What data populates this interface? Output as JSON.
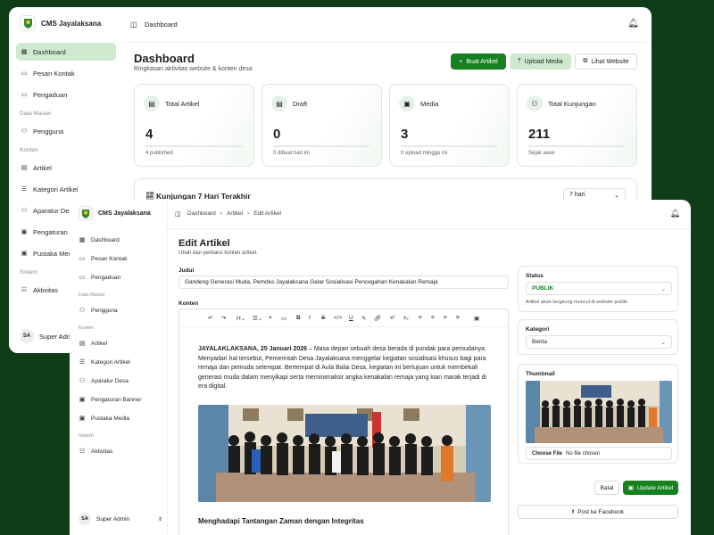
{
  "brand": {
    "name": "CMS Jayalaksana"
  },
  "dashboard": {
    "breadcrumb": "Dashboard",
    "title": "Dashboard",
    "subtitle": "Ringkasan aktivitas website & konten desa",
    "buttons": {
      "create": "Buat Artikel",
      "upload": "Upload Media",
      "view": "Lihat Website"
    },
    "stats": [
      {
        "label": "Total Artikel",
        "value": "4",
        "sub": "4 published",
        "icon": "document-icon"
      },
      {
        "label": "Draft",
        "value": "0",
        "sub": "0 dibuat hari ini",
        "icon": "draft-icon"
      },
      {
        "label": "Media",
        "value": "3",
        "sub": "0 upload minggu ini",
        "icon": "image-icon"
      },
      {
        "label": "Total Kunjungan",
        "value": "211",
        "sub": "Sejak awal",
        "icon": "users-icon"
      }
    ],
    "visits": {
      "title": "Kunjungan 7 Hari Terakhir",
      "range": "7 hari"
    }
  },
  "sidebar": {
    "items": [
      "Dashboard",
      "Pesan Kontak",
      "Pengaduan"
    ],
    "master_label": "Data Master",
    "master_items": [
      "Pengguna"
    ],
    "konten_label": "Konten",
    "konten_items_back": [
      "Artikel",
      "Kategori Artikel",
      "Aparatur Des",
      "Pengaturan B",
      "Pustaka Med"
    ],
    "konten_items": [
      "Artikel",
      "Kategori Artikel",
      "Aparatur Desa",
      "Pengaturan Banner",
      "Pustaka Media"
    ],
    "sistem_label": "Sistem",
    "sistem_items": [
      "Aktivitas"
    ],
    "user_back": "Super Admi",
    "user": "Super Admin",
    "avatar": "SA"
  },
  "editor": {
    "breadcrumb": [
      "Dashboard",
      "Artikel",
      "Edit Artikel"
    ],
    "title": "Edit Artikel",
    "subtitle": "Ubah dan perbarui konten artikel.",
    "judul_label": "Judul",
    "judul_value": "Gandeng Generasi Muda, Pemdes Jayalaksana Gelar Sosialisasi Pencegahan Kenakalan Remaja",
    "konten_label": "Konten",
    "body_lead": "JAYALAKLAKSANA, 25 Januari 2026",
    "body_text": " – Masa depan sebuah desa berada di pundak para pemudanya. Menyadari hal tersebut, Pemerintah Desa Jayalaksana menggelar kegiatan sosialisasi khusus bagi para remaja dan pemuda setempat. Bertempat di Aula Balai Desa, kegiatan ini bertujuan untuk membekali generasi muda dalam menyikapi serta meminimalisir angka kenakalan remaja yang kian marak terjadi di era digital.",
    "subheading": "Menghadapi Tantangan Zaman dengan Integritas",
    "status_label": "Status",
    "status_value": "PUBLIK",
    "status_hint": "Artikel akan langsung muncul di website publik.",
    "kategori_label": "Kategori",
    "kategori_value": "Berita",
    "thumb_label": "Thumbnail",
    "file_button": "Choose File",
    "file_status": "No file chosen",
    "cancel": "Batal",
    "update": "Update Artikel",
    "facebook": "Post ke Facebook"
  },
  "colors": {
    "accent": "#17801f",
    "accent_soft": "#cfe9cf",
    "bg": "#0f3d18"
  }
}
